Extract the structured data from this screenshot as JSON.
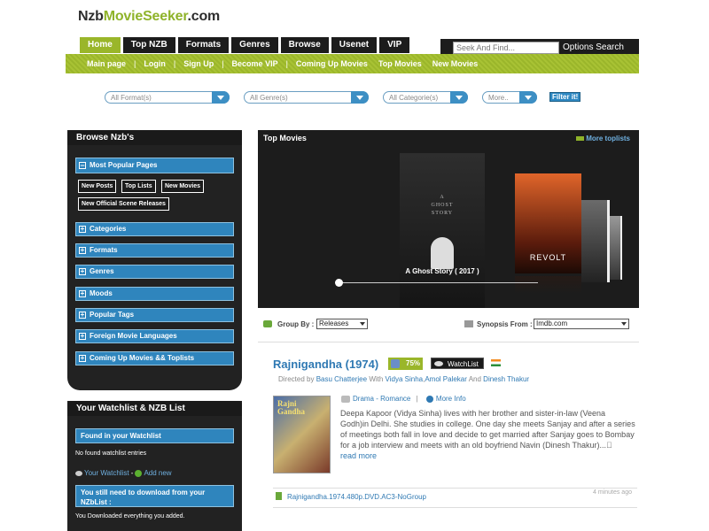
{
  "logo": {
    "part1": "Nzb",
    "part2": "MovieSeeker",
    "part3": ".com"
  },
  "tabs": [
    "Home",
    "Top NZB",
    "Formats",
    "Genres",
    "Browse",
    "Usenet",
    "VIP"
  ],
  "search": {
    "placeholder": "Seek And Find...",
    "options_label": "Options Search"
  },
  "subnav": [
    "Main page",
    "Login",
    "Sign Up",
    "Become VIP",
    "Coming Up Movies",
    "Top Movies",
    "New Movies"
  ],
  "filters": {
    "format": "All Format(s)",
    "genre": "All Genre(s)",
    "category": "All Categorie(s)",
    "more": "More..",
    "button": "Filter it!"
  },
  "browse": {
    "title": "Browse Nzb's",
    "most_popular": "Most Popular Pages",
    "chips": [
      "New Posts",
      "Top Lists",
      "New Movies",
      "New Official Scene Releases"
    ],
    "sections": [
      "Categories",
      "Formats",
      "Genres",
      "Moods",
      "Popular Tags",
      "Foreign Movie Languages",
      "Coming Up Movies && Toplists"
    ]
  },
  "watchlist": {
    "title": "Your Watchlist & NZB List",
    "found": "Found in your Watchlist",
    "none": "No found watchlist entries",
    "your_watchlist": "Your Watchlist",
    "dash": "-",
    "add_new": "Add new",
    "need_download": "You still need to download from your NZbList :",
    "downloaded": "You Downloaded everything you added."
  },
  "top_movies": {
    "title": "Top Movies",
    "more": "More toplists",
    "poster_text": "A\nGHOST\nSTORY",
    "caption": "A Ghost Story ( 2017 )",
    "second_poster": "REVOLT"
  },
  "group": {
    "label": "Group By :",
    "value": "Releases",
    "synopsis_label": "Synopsis From :",
    "synopsis_value": "Imdb.com"
  },
  "movie": {
    "title": "Rajnigandha (1974)",
    "rating": "75%",
    "watchlist": "WatchList",
    "credits_prefix": "Directed by",
    "director": "Basu Chatterjee",
    "with": "With",
    "cast1": "Vidya Sinha",
    "cast_sep": ",",
    "cast2": "Amol Palekar",
    "and": "And",
    "cast3": "Dinesh Thakur",
    "poster_text": "Rajni\nGandha",
    "genres": "Drama - Romance",
    "sep": "|",
    "more_info": "More Info",
    "synopsis": "Deepa Kapoor (Vidya Sinha) lives with her brother and sister-in-law (Veena Godh)in Delhi. She studies in college. One day she meets Sanjay and after a series of meetings both fall in love and decide to get married after Sanjay goes to Bombay for a job interview and meets with an old boyfriend Navin (Dinesh Thakur)...\u0000",
    "read_more": "read more",
    "file": "Rajnigandha.1974.480p.DVD.AC3-NoGroup",
    "time": "4 minutes ago"
  }
}
